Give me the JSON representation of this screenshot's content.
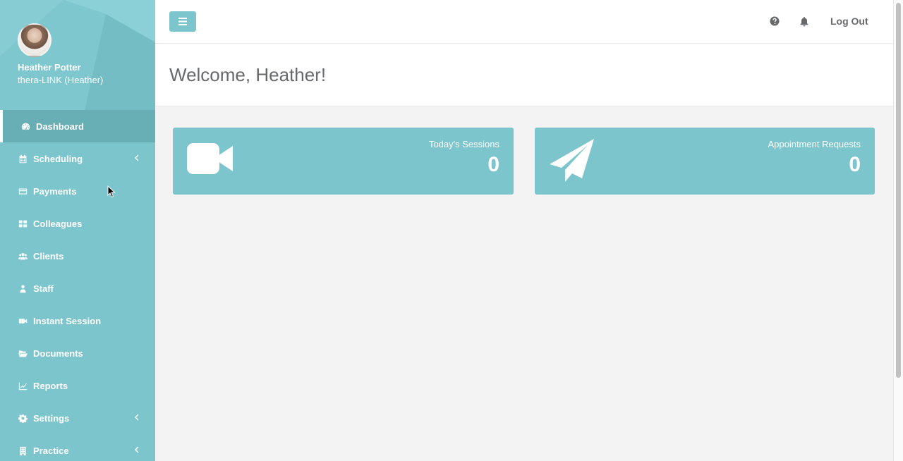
{
  "profile": {
    "name": "Heather Potter",
    "organization": "thera-LINK (Heather)"
  },
  "sidebar": {
    "items": [
      {
        "label": "Dashboard",
        "icon": "dashboard-icon",
        "active": true
      },
      {
        "label": "Scheduling",
        "icon": "calendar-icon",
        "has_submenu": true
      },
      {
        "label": "Payments",
        "icon": "credit-card-icon"
      },
      {
        "label": "Colleagues",
        "icon": "grid-icon"
      },
      {
        "label": "Clients",
        "icon": "users-icon"
      },
      {
        "label": "Staff",
        "icon": "staff-icon"
      },
      {
        "label": "Instant Session",
        "icon": "video-camera-icon"
      },
      {
        "label": "Documents",
        "icon": "folder-open-icon"
      },
      {
        "label": "Reports",
        "icon": "line-chart-icon"
      },
      {
        "label": "Settings",
        "icon": "gear-icon",
        "has_submenu": true
      },
      {
        "label": "Practice",
        "icon": "building-icon",
        "has_submenu": true
      }
    ]
  },
  "topbar": {
    "logout_label": "Log Out",
    "help_icon": "question-circle-icon",
    "notifications_icon": "bell-icon",
    "menu_icon": "hamburger-icon"
  },
  "page": {
    "welcome": "Welcome, Heather!"
  },
  "cards": [
    {
      "label": "Today's Sessions",
      "value": "0",
      "icon": "video-camera-icon"
    },
    {
      "label": "Appointment Requests",
      "value": "0",
      "icon": "paper-plane-icon"
    }
  ],
  "colors": {
    "accent": "#7cc5cc",
    "accent_dark": "#67aeb5",
    "text": "#676a6c",
    "background": "#f3f3f4"
  }
}
